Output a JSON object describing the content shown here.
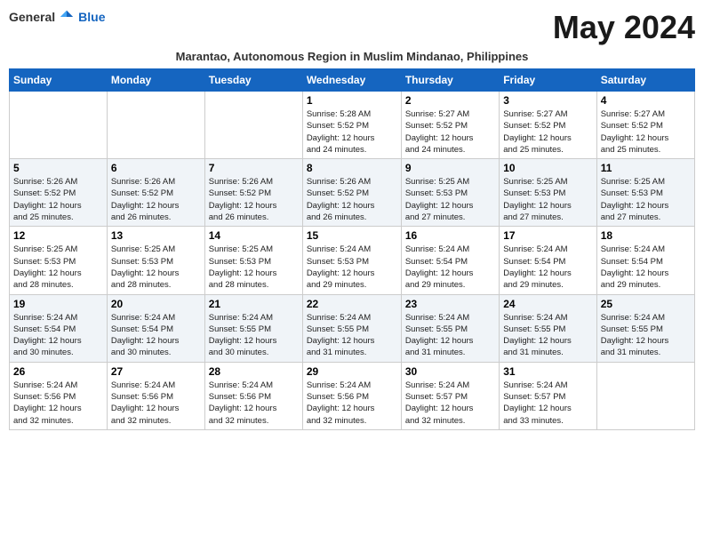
{
  "logo": {
    "general": "General",
    "blue": "Blue"
  },
  "title": "May 2024",
  "subtitle": "Marantao, Autonomous Region in Muslim Mindanao, Philippines",
  "headers": [
    "Sunday",
    "Monday",
    "Tuesday",
    "Wednesday",
    "Thursday",
    "Friday",
    "Saturday"
  ],
  "weeks": [
    [
      {
        "day": "",
        "info": ""
      },
      {
        "day": "",
        "info": ""
      },
      {
        "day": "",
        "info": ""
      },
      {
        "day": "1",
        "info": "Sunrise: 5:28 AM\nSunset: 5:52 PM\nDaylight: 12 hours\nand 24 minutes."
      },
      {
        "day": "2",
        "info": "Sunrise: 5:27 AM\nSunset: 5:52 PM\nDaylight: 12 hours\nand 24 minutes."
      },
      {
        "day": "3",
        "info": "Sunrise: 5:27 AM\nSunset: 5:52 PM\nDaylight: 12 hours\nand 25 minutes."
      },
      {
        "day": "4",
        "info": "Sunrise: 5:27 AM\nSunset: 5:52 PM\nDaylight: 12 hours\nand 25 minutes."
      }
    ],
    [
      {
        "day": "5",
        "info": "Sunrise: 5:26 AM\nSunset: 5:52 PM\nDaylight: 12 hours\nand 25 minutes."
      },
      {
        "day": "6",
        "info": "Sunrise: 5:26 AM\nSunset: 5:52 PM\nDaylight: 12 hours\nand 26 minutes."
      },
      {
        "day": "7",
        "info": "Sunrise: 5:26 AM\nSunset: 5:52 PM\nDaylight: 12 hours\nand 26 minutes."
      },
      {
        "day": "8",
        "info": "Sunrise: 5:26 AM\nSunset: 5:52 PM\nDaylight: 12 hours\nand 26 minutes."
      },
      {
        "day": "9",
        "info": "Sunrise: 5:25 AM\nSunset: 5:53 PM\nDaylight: 12 hours\nand 27 minutes."
      },
      {
        "day": "10",
        "info": "Sunrise: 5:25 AM\nSunset: 5:53 PM\nDaylight: 12 hours\nand 27 minutes."
      },
      {
        "day": "11",
        "info": "Sunrise: 5:25 AM\nSunset: 5:53 PM\nDaylight: 12 hours\nand 27 minutes."
      }
    ],
    [
      {
        "day": "12",
        "info": "Sunrise: 5:25 AM\nSunset: 5:53 PM\nDaylight: 12 hours\nand 28 minutes."
      },
      {
        "day": "13",
        "info": "Sunrise: 5:25 AM\nSunset: 5:53 PM\nDaylight: 12 hours\nand 28 minutes."
      },
      {
        "day": "14",
        "info": "Sunrise: 5:25 AM\nSunset: 5:53 PM\nDaylight: 12 hours\nand 28 minutes."
      },
      {
        "day": "15",
        "info": "Sunrise: 5:24 AM\nSunset: 5:53 PM\nDaylight: 12 hours\nand 29 minutes."
      },
      {
        "day": "16",
        "info": "Sunrise: 5:24 AM\nSunset: 5:54 PM\nDaylight: 12 hours\nand 29 minutes."
      },
      {
        "day": "17",
        "info": "Sunrise: 5:24 AM\nSunset: 5:54 PM\nDaylight: 12 hours\nand 29 minutes."
      },
      {
        "day": "18",
        "info": "Sunrise: 5:24 AM\nSunset: 5:54 PM\nDaylight: 12 hours\nand 29 minutes."
      }
    ],
    [
      {
        "day": "19",
        "info": "Sunrise: 5:24 AM\nSunset: 5:54 PM\nDaylight: 12 hours\nand 30 minutes."
      },
      {
        "day": "20",
        "info": "Sunrise: 5:24 AM\nSunset: 5:54 PM\nDaylight: 12 hours\nand 30 minutes."
      },
      {
        "day": "21",
        "info": "Sunrise: 5:24 AM\nSunset: 5:55 PM\nDaylight: 12 hours\nand 30 minutes."
      },
      {
        "day": "22",
        "info": "Sunrise: 5:24 AM\nSunset: 5:55 PM\nDaylight: 12 hours\nand 31 minutes."
      },
      {
        "day": "23",
        "info": "Sunrise: 5:24 AM\nSunset: 5:55 PM\nDaylight: 12 hours\nand 31 minutes."
      },
      {
        "day": "24",
        "info": "Sunrise: 5:24 AM\nSunset: 5:55 PM\nDaylight: 12 hours\nand 31 minutes."
      },
      {
        "day": "25",
        "info": "Sunrise: 5:24 AM\nSunset: 5:55 PM\nDaylight: 12 hours\nand 31 minutes."
      }
    ],
    [
      {
        "day": "26",
        "info": "Sunrise: 5:24 AM\nSunset: 5:56 PM\nDaylight: 12 hours\nand 32 minutes."
      },
      {
        "day": "27",
        "info": "Sunrise: 5:24 AM\nSunset: 5:56 PM\nDaylight: 12 hours\nand 32 minutes."
      },
      {
        "day": "28",
        "info": "Sunrise: 5:24 AM\nSunset: 5:56 PM\nDaylight: 12 hours\nand 32 minutes."
      },
      {
        "day": "29",
        "info": "Sunrise: 5:24 AM\nSunset: 5:56 PM\nDaylight: 12 hours\nand 32 minutes."
      },
      {
        "day": "30",
        "info": "Sunrise: 5:24 AM\nSunset: 5:57 PM\nDaylight: 12 hours\nand 32 minutes."
      },
      {
        "day": "31",
        "info": "Sunrise: 5:24 AM\nSunset: 5:57 PM\nDaylight: 12 hours\nand 33 minutes."
      },
      {
        "day": "",
        "info": ""
      }
    ]
  ]
}
